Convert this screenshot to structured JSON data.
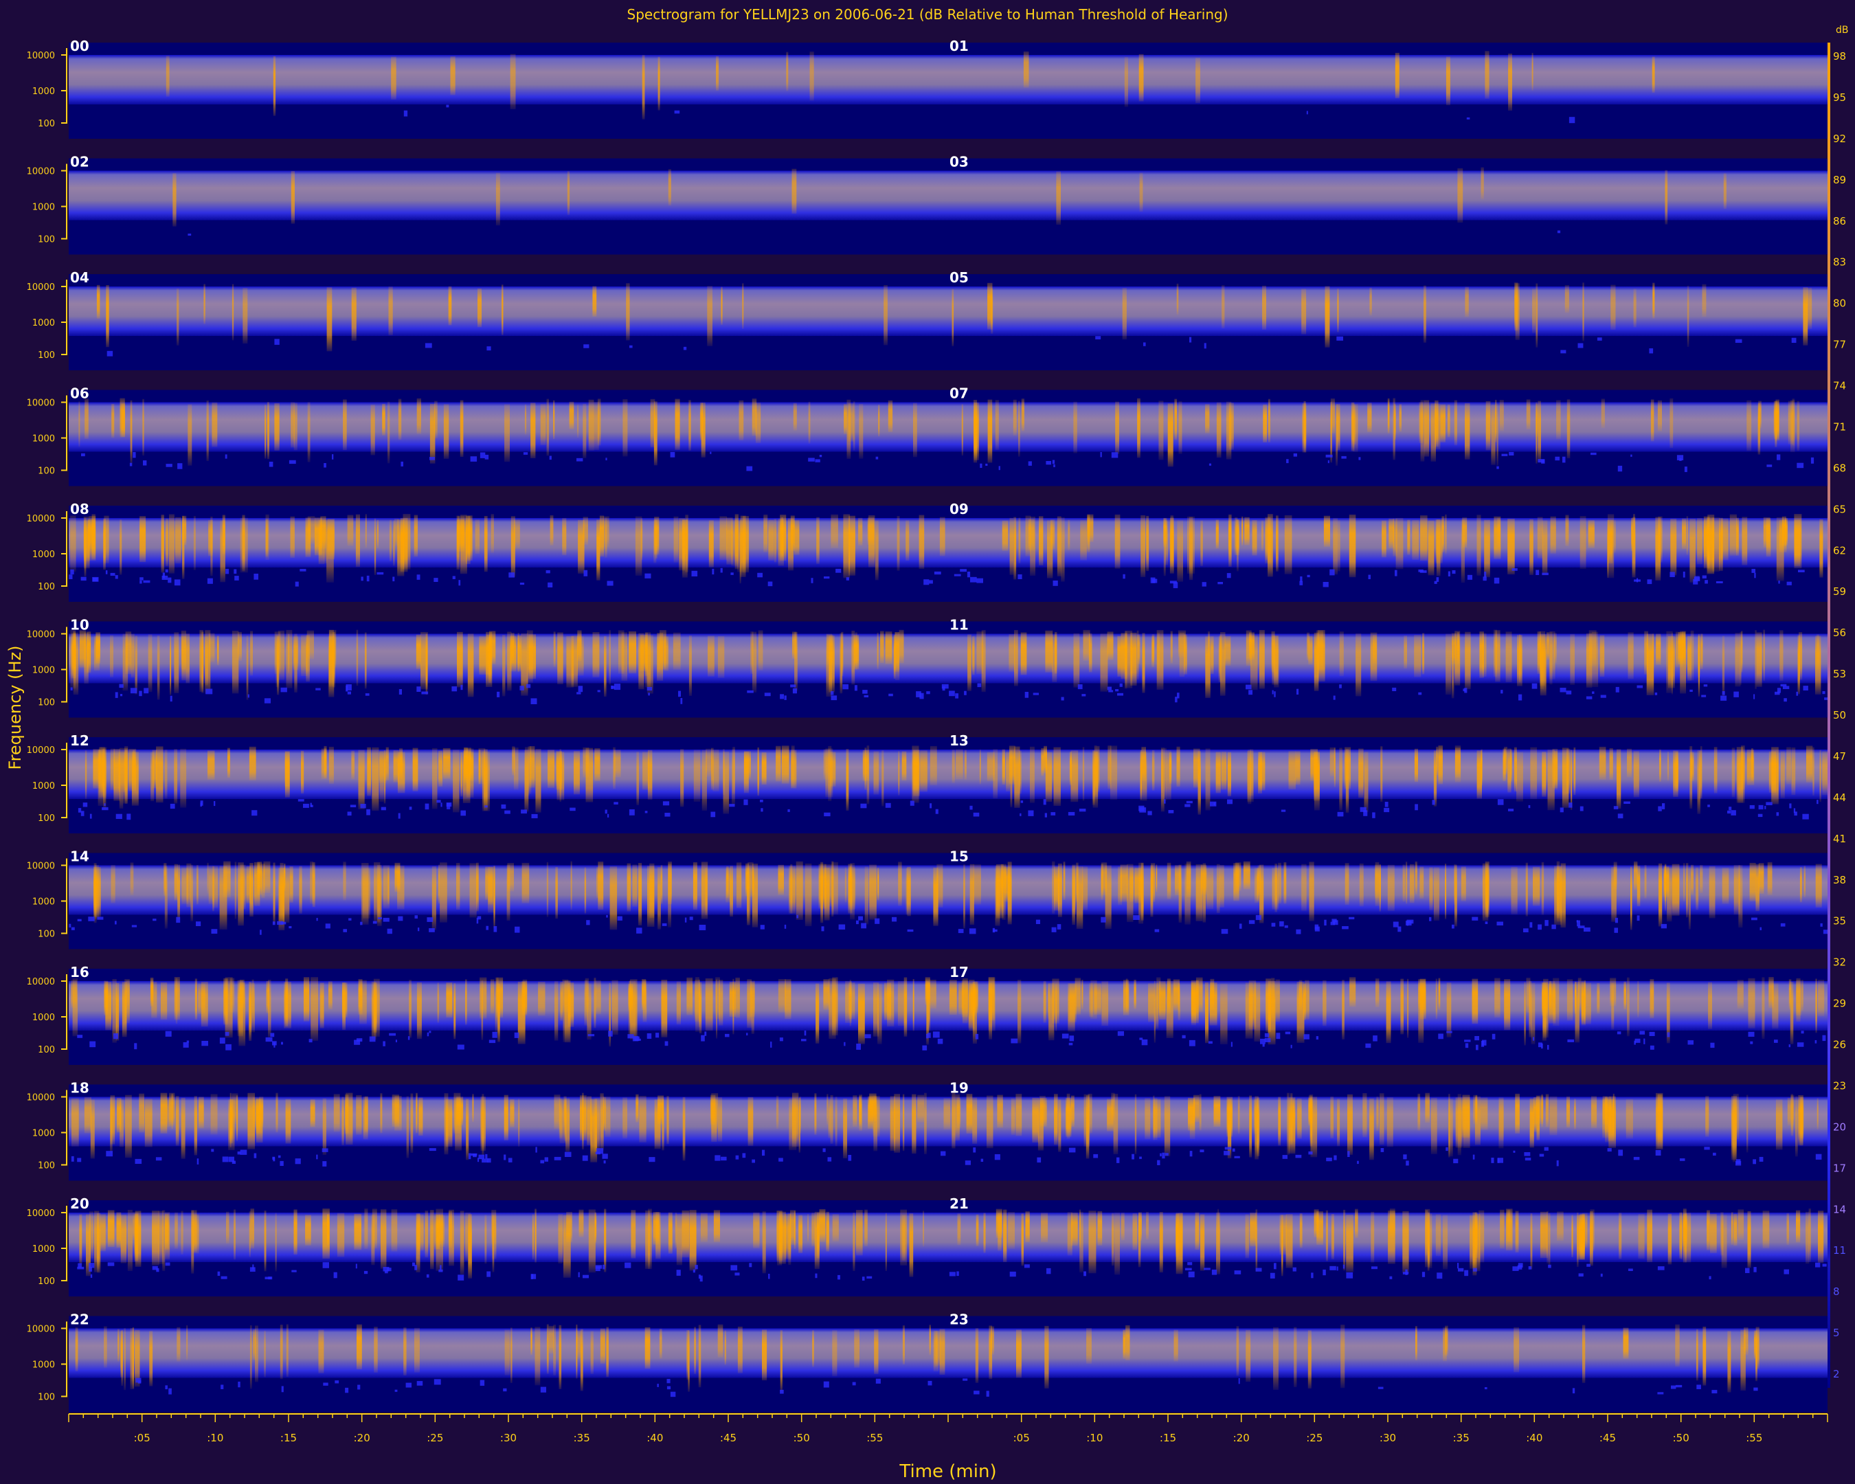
{
  "chart_data": {
    "type": "heatmap",
    "title": "Spectrogram for YELLMJ23 on 2006-06-21 (dB Relative to Human Threshold of Hearing)",
    "xlabel": "Time (min)",
    "ylabel": "Frequency (Hz)",
    "x_ticks": [
      ":05",
      ":10",
      ":15",
      ":20",
      ":25",
      ":30",
      ":35",
      ":40",
      ":45",
      ":50",
      ":55"
    ],
    "y_ticks": [
      "10000",
      "1000",
      "100"
    ],
    "hour_labels": [
      "00",
      "01",
      "02",
      "03",
      "04",
      "05",
      "06",
      "07",
      "08",
      "09",
      "10",
      "11",
      "12",
      "13",
      "14",
      "15",
      "16",
      "17",
      "18",
      "19",
      "20",
      "21",
      "22",
      "23"
    ],
    "colorbar_label": "dB",
    "colorbar_ticks": [
      "98",
      "95",
      "92",
      "89",
      "86",
      "83",
      "80",
      "77",
      "74",
      "71",
      "68",
      "65",
      "62",
      "59",
      "56",
      "53",
      "50",
      "47",
      "44",
      "41",
      "38",
      "35",
      "32",
      "29",
      "26",
      "23",
      "20",
      "17",
      "14",
      "11",
      "8",
      "5",
      "2"
    ],
    "colorbar_range": [
      2,
      100
    ],
    "colors": {
      "background": "#1c0a3c",
      "low": "#00006e",
      "mid": "#1414ff",
      "high": "#ffa500",
      "axis": "#ffd21a"
    },
    "hour_activity": [
      0.05,
      0.05,
      0.02,
      0.02,
      0.12,
      0.18,
      0.45,
      0.55,
      0.85,
      0.85,
      0.9,
      0.9,
      0.92,
      0.92,
      0.9,
      0.9,
      0.92,
      0.92,
      0.9,
      0.9,
      0.85,
      0.8,
      0.45,
      0.22
    ]
  }
}
